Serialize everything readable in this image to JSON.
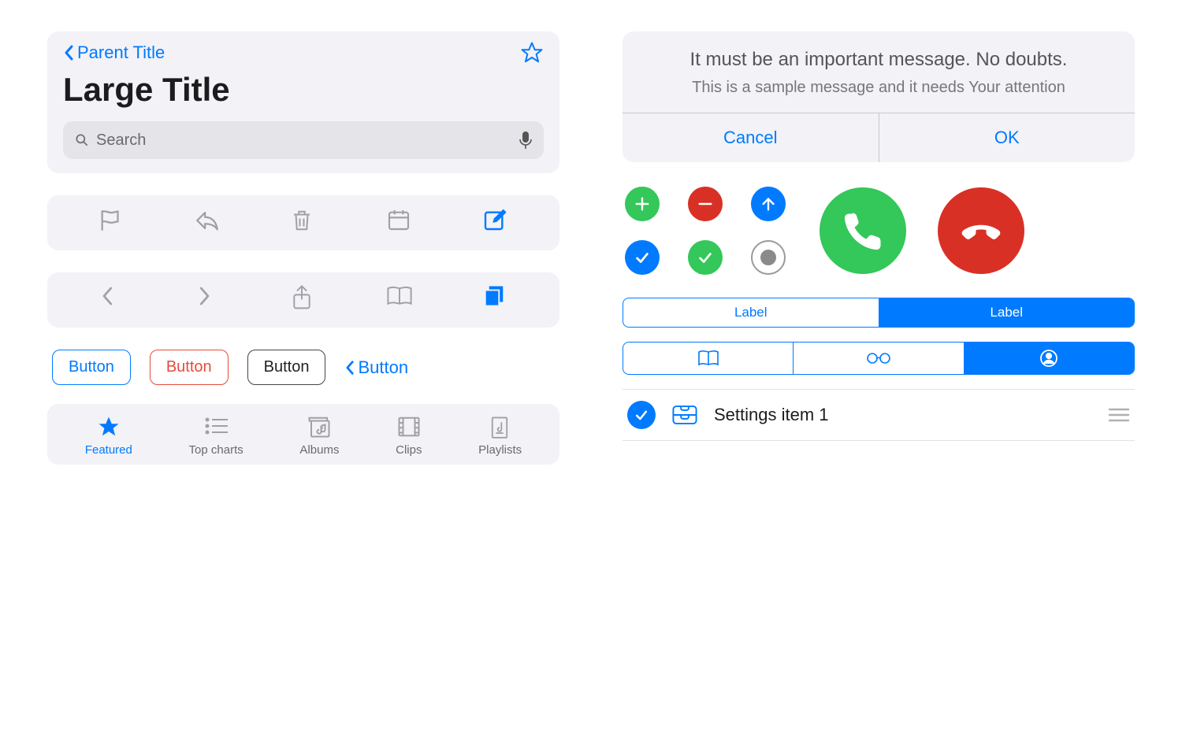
{
  "nav": {
    "parent_title": "Parent Title",
    "large_title": "Large Title",
    "search_placeholder": "Search"
  },
  "buttons": {
    "primary": "Button",
    "danger": "Button",
    "neutral": "Button",
    "back": "Button"
  },
  "tabbar": [
    {
      "label": "Featured",
      "active": true
    },
    {
      "label": "Top charts",
      "active": false
    },
    {
      "label": "Albums",
      "active": false
    },
    {
      "label": "Clips",
      "active": false
    },
    {
      "label": "Playlists",
      "active": false
    }
  ],
  "dialog": {
    "title": "It must be an important message. No doubts.",
    "message": "This is a sample message and it needs Your attention",
    "cancel": "Cancel",
    "ok": "OK"
  },
  "segments": {
    "text": [
      "Label",
      "Label"
    ]
  },
  "settings": {
    "item1": "Settings item 1"
  },
  "colors": {
    "blue": "#007aff",
    "green": "#34c759",
    "red": "#d93025"
  }
}
